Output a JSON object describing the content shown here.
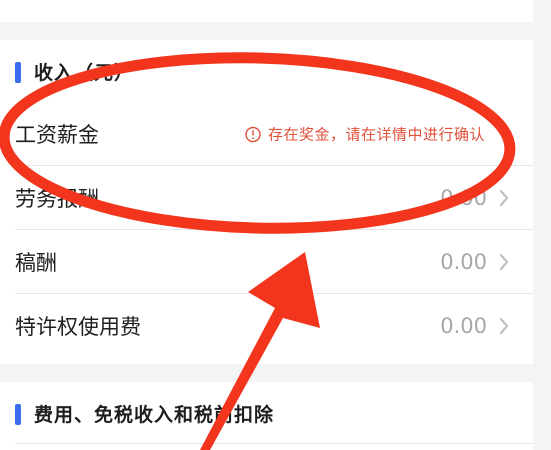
{
  "colors": {
    "accent": "#3a6cf0",
    "warning": "#e0513a",
    "annotation_red": "#f2351c"
  },
  "income_section": {
    "title": "收入（元）",
    "rows": [
      {
        "label": "工资薪金",
        "warning_text": "存在奖金，请在详情中进行确认",
        "warning_icon": "alert-circle-icon"
      },
      {
        "label": "劳务报酬",
        "value": "0.00",
        "icon": "chevron-right-icon"
      },
      {
        "label": "稿酬",
        "value": "0.00",
        "icon": "chevron-right-icon"
      },
      {
        "label": "特许权使用费",
        "value": "0.00",
        "icon": "chevron-right-icon"
      }
    ]
  },
  "deduction_section": {
    "title": "费用、免税收入和税前扣除"
  },
  "annotations": {
    "circle_color": "#f2351c",
    "arrow_color": "#f2351c"
  }
}
